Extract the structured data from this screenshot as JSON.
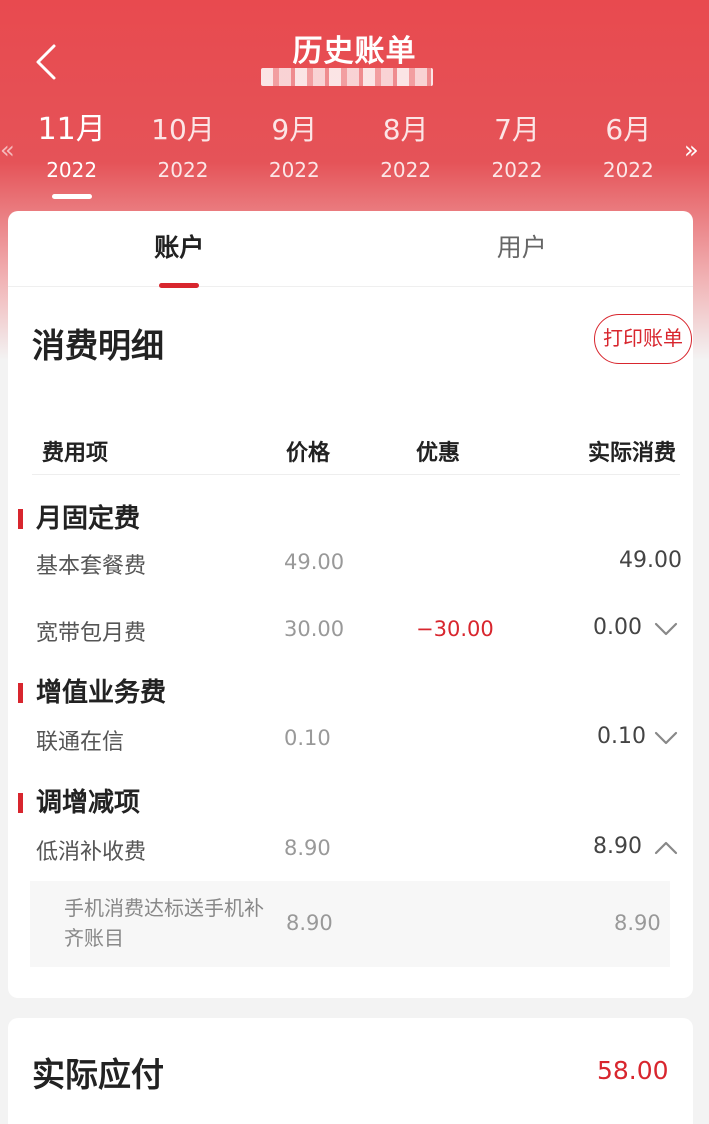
{
  "header": {
    "title": "历史账单",
    "back_icon": "chevron-left-icon",
    "prev_icon": "«",
    "next_icon": "»"
  },
  "months": [
    {
      "month": "11月",
      "year": "2022",
      "active": true
    },
    {
      "month": "10月",
      "year": "2022"
    },
    {
      "month": "9月",
      "year": "2022"
    },
    {
      "month": "8月",
      "year": "2022"
    },
    {
      "month": "7月",
      "year": "2022"
    },
    {
      "month": "6月",
      "year": "2022"
    }
  ],
  "tabs": {
    "account": "账户",
    "user": "用户"
  },
  "detail": {
    "title": "消费明细",
    "print_label": "打印账单",
    "columns": {
      "item": "费用项",
      "price": "价格",
      "discount": "优惠",
      "actual": "实际消费"
    },
    "groups": [
      {
        "name": "月固定费",
        "rows": [
          {
            "name": "基本套餐费",
            "price": "49.00",
            "discount": "",
            "actual": "49.00"
          },
          {
            "name": "宽带包月费",
            "price": "30.00",
            "discount": "−30.00",
            "actual": "0.00",
            "expand": "down"
          }
        ]
      },
      {
        "name": "增值业务费",
        "rows": [
          {
            "name": "联通在信",
            "price": "0.10",
            "discount": "",
            "actual": "0.10",
            "expand": "down"
          }
        ]
      },
      {
        "name": "调增减项",
        "rows": [
          {
            "name": "低消补收费",
            "price": "8.90",
            "discount": "",
            "actual": "8.90",
            "expand": "up"
          }
        ],
        "sub": {
          "name": "手机消费达标送手机补齐账目",
          "price": "8.90",
          "actual": "8.90"
        }
      }
    ]
  },
  "total": {
    "label": "实际应付",
    "amount": "58.00"
  },
  "colors": {
    "brand_red": "#d8262e",
    "header_red": "#e84a4f"
  }
}
